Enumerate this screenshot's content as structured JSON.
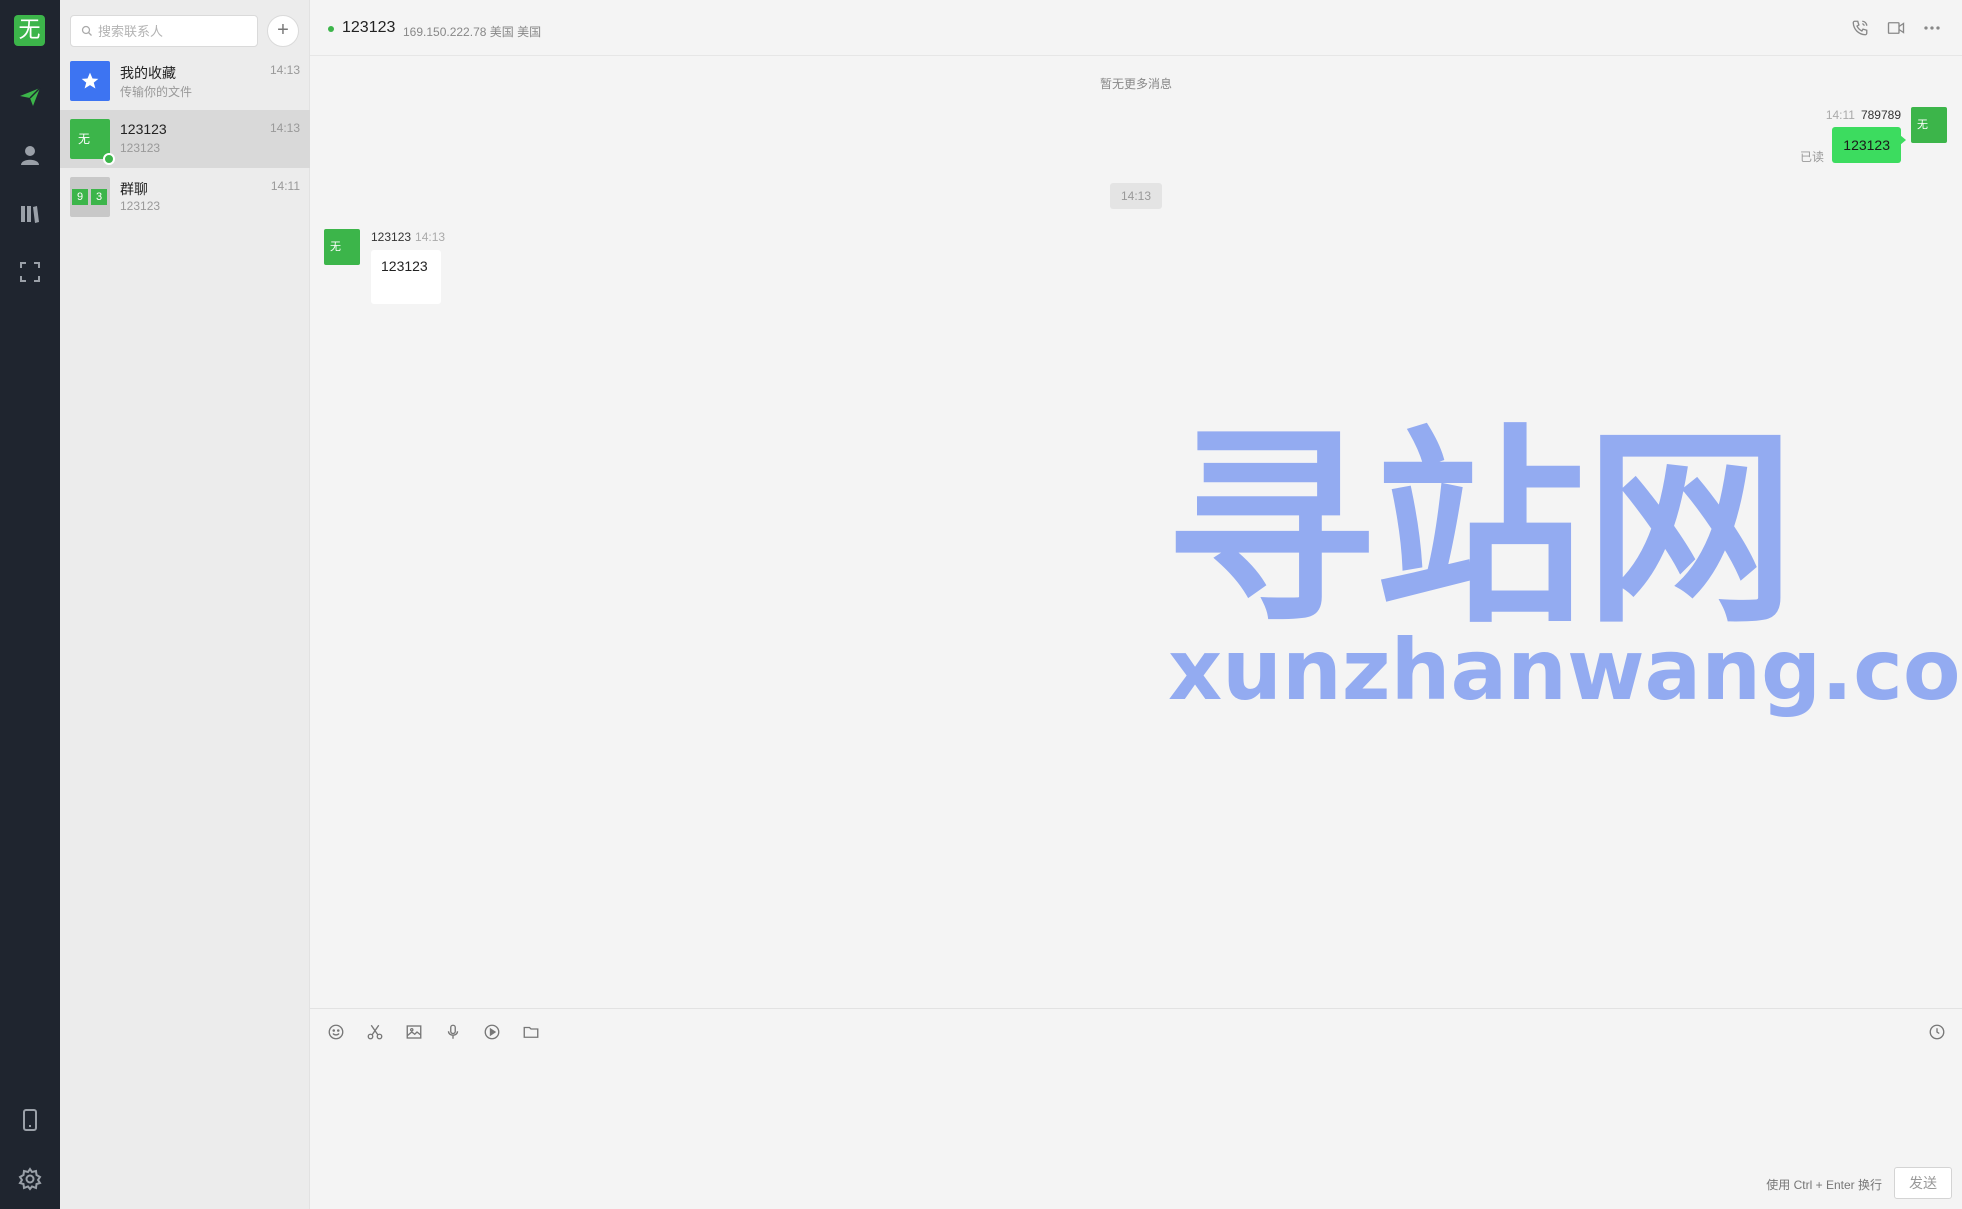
{
  "app": {
    "logo_text": "无"
  },
  "nav": {
    "items": [
      {
        "name": "chat",
        "active": true
      },
      {
        "name": "contacts"
      },
      {
        "name": "files"
      },
      {
        "name": "scan"
      },
      {
        "name": "mobile"
      },
      {
        "name": "settings"
      }
    ]
  },
  "search": {
    "placeholder": "搜索联系人",
    "value": ""
  },
  "add_label": "+",
  "contacts": [
    {
      "name": "我的收藏",
      "sub": "传输你的文件",
      "time": "14:13",
      "avatar": "star-icon"
    },
    {
      "name": "123123",
      "sub": "123123",
      "time": "14:13",
      "avatar_text": "无",
      "active": true,
      "online": true
    },
    {
      "name": "群聊",
      "sub": "123123",
      "time": "14:11",
      "avatar_tiles": [
        "9",
        "3"
      ]
    }
  ],
  "chat": {
    "title": "123123",
    "ip": "169.150.222.78 美国 美国",
    "no_more": "暂无更多消息",
    "messages": {
      "outgoing": {
        "time": "14:11",
        "sender": "789789",
        "text": "123123",
        "avatar_text": "无",
        "read": "已读"
      },
      "separator_time": "14:13",
      "incoming": {
        "sender": "123123",
        "time": "14:13",
        "text": "123123",
        "avatar_text": "无"
      }
    }
  },
  "watermark": {
    "cn": "寻站网",
    "en": "xunzhanwang.com"
  },
  "composer": {
    "placeholder": "",
    "hint": "使用 Ctrl + Enter 换行",
    "send_label": "发送"
  },
  "colors": {
    "accent": "#3cb54a",
    "bubble_out": "#3cdc5f",
    "rail": "#1f252f",
    "fav": "#3d74f2",
    "watermark": "#8ea8f1"
  }
}
